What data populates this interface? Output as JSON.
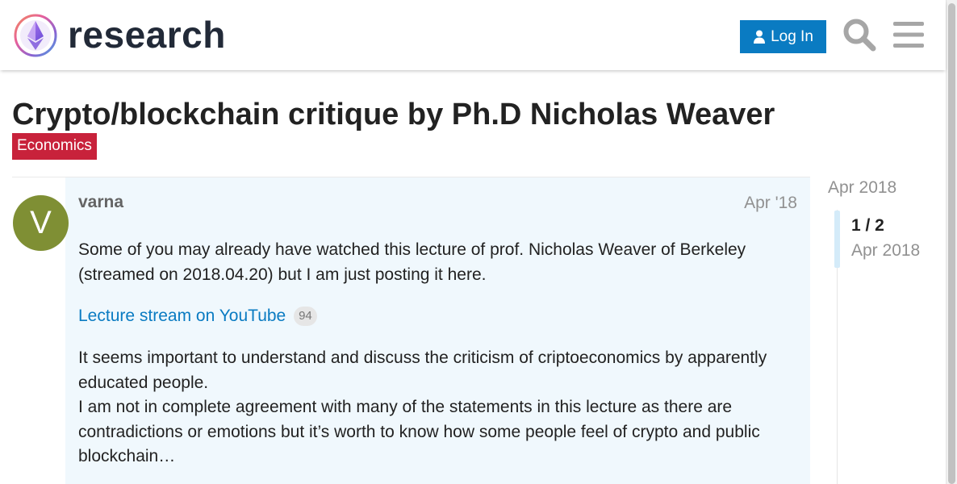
{
  "header": {
    "site_name": "research",
    "login_label": "Log In",
    "icons": [
      "ethereum-logo",
      "user-icon",
      "search-icon",
      "hamburger-menu-icon"
    ]
  },
  "topic": {
    "title": "Crypto/blockchain critique by Ph.D Nicholas Weaver",
    "category": "Economics",
    "category_color": "#c8223b"
  },
  "post": {
    "avatar_letter": "V",
    "avatar_color": "#7f8f34",
    "username": "varna",
    "date": "Apr '18",
    "paragraph1": "Some of you may already have watched this lecture of prof. Nicholas Weaver of Berkeley (streamed on 2018.04.20) but I am just posting it here.",
    "link_text": "Lecture stream on YouTube",
    "link_clicks": "94",
    "paragraph2": "It seems important to understand and discuss the criticism of criptoeconomics by apparently educated people.",
    "paragraph3": "I am not in complete agreement with many of the statements in this lecture as there are contradictions or emotions but it’s worth to know how some people feel of crypto and public blockchain…"
  },
  "timeline": {
    "top_date": "Apr 2018",
    "position": "1 / 2",
    "current_date": "Apr 2018"
  },
  "colors": {
    "accent": "#0a7bc2",
    "post_background": "#f0f8fd"
  }
}
